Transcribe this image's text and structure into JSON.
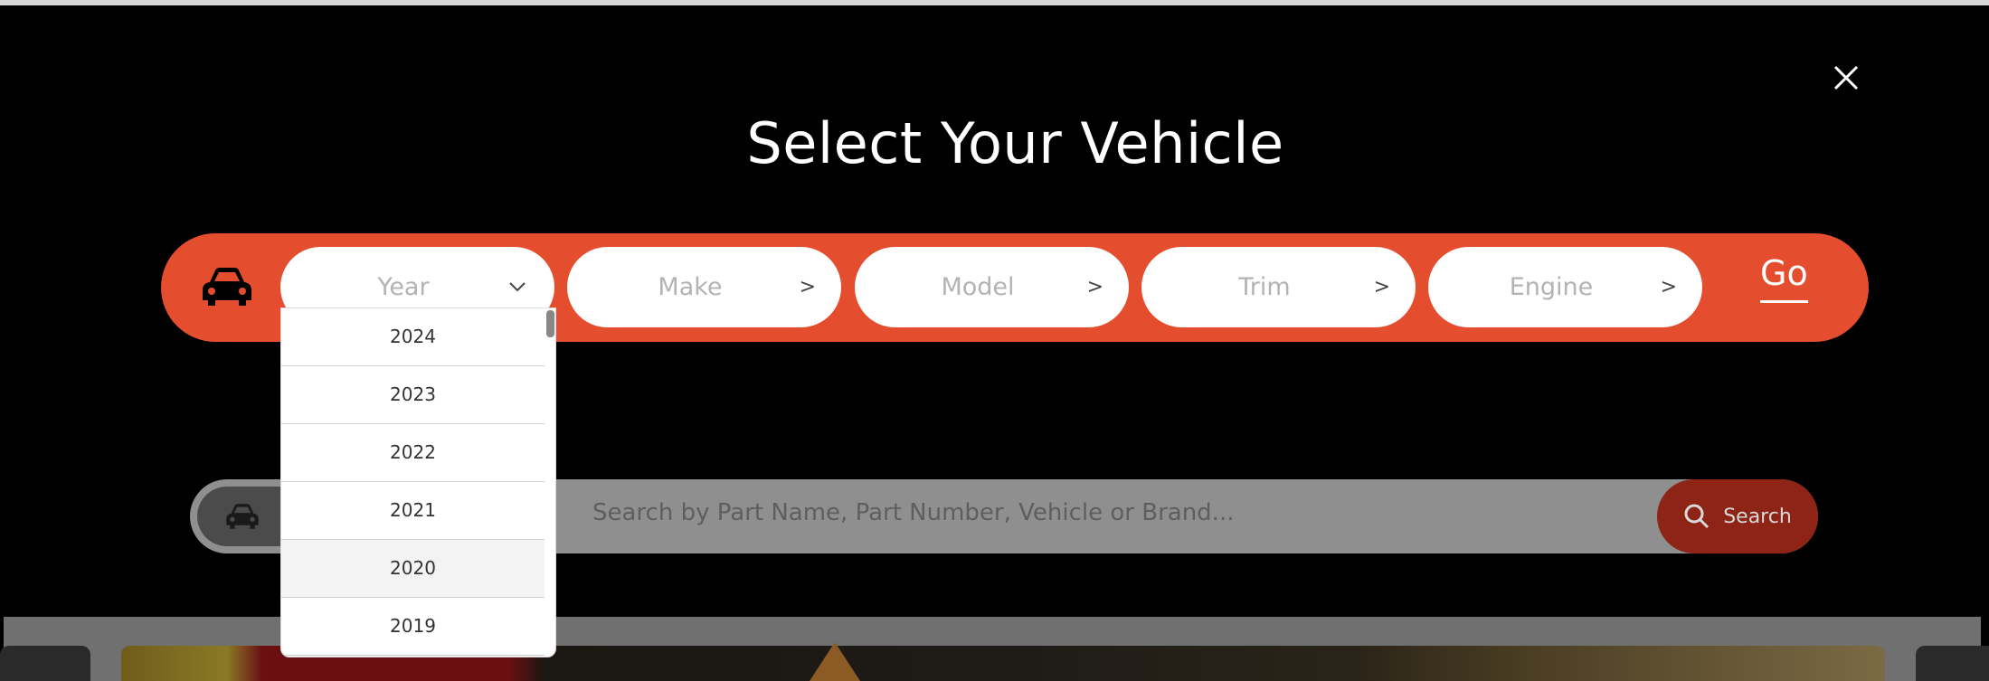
{
  "modal": {
    "title": "Select Your Vehicle",
    "go_label": "Go",
    "close_icon": "close-icon",
    "accent_color": "#e44e2f"
  },
  "selectors": [
    {
      "label": "Year",
      "indicator": "chevron-down"
    },
    {
      "label": "Make",
      "indicator": ">"
    },
    {
      "label": "Model",
      "indicator": ">"
    },
    {
      "label": "Trim",
      "indicator": ">"
    },
    {
      "label": "Engine",
      "indicator": ">"
    }
  ],
  "year_dropdown": {
    "options": [
      "2024",
      "2023",
      "2022",
      "2021",
      "2020",
      "2019"
    ],
    "highlighted": "2020"
  },
  "background_search": {
    "placeholder": "Search by Part Name, Part Number, Vehicle or Brand...",
    "button_label": "Search"
  }
}
